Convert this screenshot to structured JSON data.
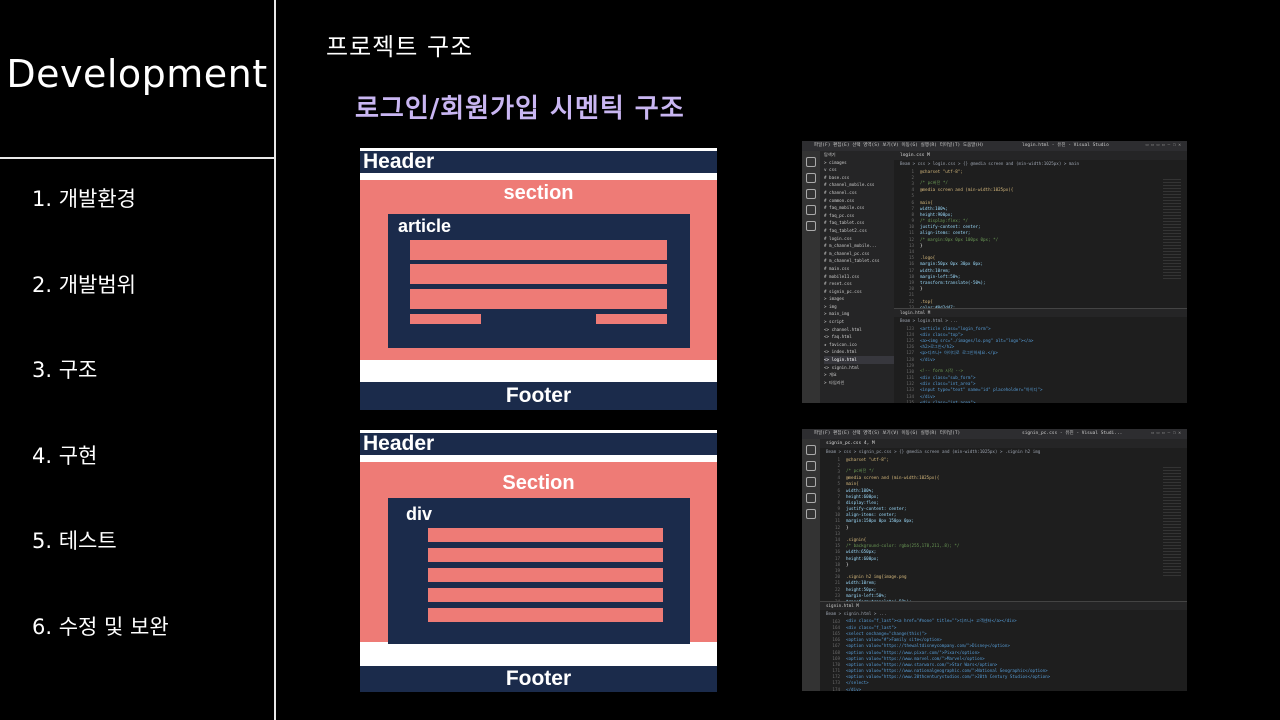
{
  "sidebar": {
    "brand": "Development",
    "items": [
      {
        "label": "1. 개발환경"
      },
      {
        "label": "2. 개발범위"
      },
      {
        "label": "3. 구조"
      },
      {
        "label": "4. 구현"
      },
      {
        "label": "5. 테스트"
      },
      {
        "label": "6. 수정 및 보완"
      }
    ]
  },
  "main": {
    "heading": "프로젝트 구조",
    "subheading": "로그인/회원가입 시멘틱 구조",
    "diagrams": [
      {
        "header": "Header",
        "section": "section",
        "inner": "article",
        "footer": "Footer"
      },
      {
        "header": "Header",
        "section": "Section",
        "inner": "div",
        "footer": "Footer"
      }
    ],
    "editors": [
      {
        "menu": "파일(F)  편집(E)  선택 영역(S)  보기(V)  이동(G)  실행(R)  터미널(T)  도움말(H)",
        "window_title": "login.html - 유진 - Visual Studio",
        "tab": "login.css M",
        "breadcrumb": "Beam > css > login.css > {} @media screen and (min-width:1025px) > main",
        "explorer": [
          "탐색기",
          "> cimages",
          "v css",
          "# base.css",
          "# channel_mobile.css",
          "# channel.css",
          "# common.css",
          "# faq_mobile.css",
          "# faq_pc.css",
          "# faq_tablet.css",
          "# faq_tablet2.css",
          "# login.css",
          "# m_channel_mobile...",
          "# m_channel_pc.css",
          "# m_channel_tablet.css",
          "# main.css",
          "# mobile11.css",
          "# reset.css",
          "# signin_pc.css",
          "> images",
          "> img",
          "> main_img",
          "> script",
          "<> channel.html",
          "<> faq.html",
          "★ favicon.ico",
          "<> index.html",
          "<> login.html",
          "<> signin.html",
          "> 개요",
          "> 타임라인"
        ],
        "explorer_active": "<> login.html",
        "code": [
          [
            "1",
            "@charset \"utf-8\";"
          ],
          [
            "2",
            ""
          ],
          [
            "3",
            "/* pc버전 */"
          ],
          [
            "4",
            "@media screen and (min-width:1025px){"
          ],
          [
            "5",
            ""
          ],
          [
            "6",
            "main{"
          ],
          [
            "7",
            "  width:100%;"
          ],
          [
            "8",
            "  height:900px;"
          ],
          [
            "9",
            "  /* display:flex; */"
          ],
          [
            "10",
            "  justify-content: center;"
          ],
          [
            "11",
            "  align-items: center;"
          ],
          [
            "12",
            "  /* margin:0px 0px 100px 0px; */"
          ],
          [
            "13",
            "}"
          ],
          [
            "14",
            ""
          ],
          [
            "15",
            ".logo{"
          ],
          [
            "16",
            "  margin:50px 0px 30px 0px;"
          ],
          [
            "17",
            "  width:10rem;"
          ],
          [
            "18",
            "  margin-left:50%;"
          ],
          [
            "19",
            "  transform:translate(-50%);"
          ],
          [
            "20",
            "}"
          ],
          [
            "21",
            ""
          ],
          [
            "22",
            "  .top{"
          ],
          [
            "23",
            "  color:#0d2d47;"
          ]
        ],
        "panel_tab": "login.html M",
        "panel_crumb": "Beam > login.html > ...",
        "panel_code": [
          [
            "123",
            "<article class=\"login_form\">"
          ],
          [
            "124",
            "  <div class=\"top\">"
          ],
          [
            "125",
            "    <a><img src=\"./images/lo.png\" alt=\"logo\"></a>"
          ],
          [
            "126",
            "    <h2>로그인</h2>"
          ],
          [
            "127",
            "    <p>디즈니+ 아이디로 로그인하세요.</p>"
          ],
          [
            "128",
            "  </div>"
          ],
          [
            "129",
            ""
          ],
          [
            "130",
            "  <!-- form 시작 -->"
          ],
          [
            "131",
            "  <div class=\"sub_form\">"
          ],
          [
            "132",
            "    <div class=\"int_area\">"
          ],
          [
            "133",
            "      <input type=\"text\" name=\"id\" placeholder=\"아이디\">"
          ],
          [
            "134",
            "    </div>"
          ],
          [
            "135",
            "    <div class=\"int_area\">"
          ],
          [
            "136",
            "      <input type=\"password\" name=\"pw\" placeholder=\"비밀번호\">"
          ],
          [
            "137",
            "    </div>"
          ]
        ]
      },
      {
        "menu": "파일(F)  편집(E)  선택 영역(S)  보기(V)  이동(G)  실행(R)  터미널(T)",
        "window_title": "signin_pc.css - 유진 - Visual Studi...",
        "tab": "signin_pc.css 4, M",
        "breadcrumb": "Beam > css > signin_pc.css > {} @media screen and (min-width:1025px) > .signin h2 img",
        "code": [
          [
            "1",
            "@charset \"utf-8\";"
          ],
          [
            "2",
            ""
          ],
          [
            "3",
            "  /* pc버전 */"
          ],
          [
            "4",
            "@media screen and (min-width:1025px){"
          ],
          [
            "5",
            "  main{"
          ],
          [
            "6",
            "    width:100%;"
          ],
          [
            "7",
            "    height:600px;"
          ],
          [
            "8",
            "    display:flex;"
          ],
          [
            "9",
            "    justify-content: center;"
          ],
          [
            "10",
            "    align-items: center;"
          ],
          [
            "11",
            "    margin:150px 0px 150px 0px;"
          ],
          [
            "12",
            "  }"
          ],
          [
            "13",
            ""
          ],
          [
            "14",
            "  .signin{"
          ],
          [
            "15",
            "    /* background-color: rgba(255,178,211,.8); */"
          ],
          [
            "16",
            "    width:650px;"
          ],
          [
            "17",
            "    height:600px;"
          ],
          [
            "18",
            "  }"
          ],
          [
            "19",
            ""
          ],
          [
            "20",
            "  .signin h2 img{image.png"
          ],
          [
            "21",
            "    width:10rem;"
          ],
          [
            "22",
            "    height:50px;"
          ],
          [
            "23",
            "    margin-left:50%;"
          ],
          [
            "24",
            "    transform:translate(-50%);"
          ],
          [
            "25",
            "  }"
          ]
        ],
        "panel_tab": "signin.html M",
        "panel_crumb": "Beam > signin.html > ...",
        "panel_code": [
          [
            "163",
            "<div class=\"f_last\"><a href=\"#none\" title=\"\">디즈니+ 고객센터</a></div>"
          ],
          [
            "164",
            "<div class=\"f_last\">"
          ],
          [
            "165",
            "  <select onchange=\"change(this)\">"
          ],
          [
            "166",
            "    <option value=\"#\">Family site</option>"
          ],
          [
            "167",
            "    <option value=\"https://thewaltdisneycompany.com/\">Disney</option>"
          ],
          [
            "168",
            "    <option value=\"https://www.pixar.com/\">Pixar</option>"
          ],
          [
            "169",
            "    <option value=\"https://www.marvel.com/\">Marvel</option>"
          ],
          [
            "170",
            "    <option value=\"https://www.starwars.com/\">Star Wars</option>"
          ],
          [
            "171",
            "    <option value=\"https://www.nationalgeographic.com/\">National Geographic</option>"
          ],
          [
            "172",
            "    <option value=\"https://www.20thcenturystudios.com/\">20th Century Studios</option>"
          ],
          [
            "173",
            "  </select>"
          ],
          [
            "174",
            "</div>"
          ],
          [
            "175",
            "<address>Disney, Disney/Pixar, MARVEL, Star Wars, NAT GEO</address>"
          ]
        ]
      }
    ]
  }
}
